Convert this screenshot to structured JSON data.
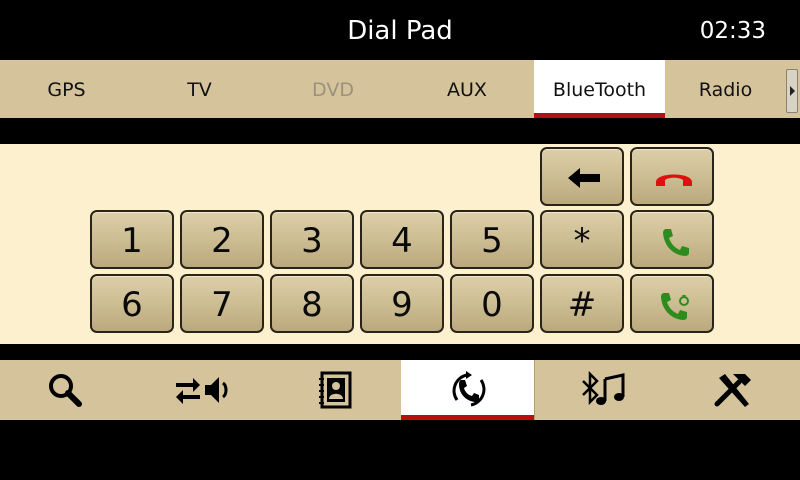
{
  "header": {
    "title": "Dial Pad",
    "clock": "02:33"
  },
  "tabs": [
    {
      "label": "GPS",
      "state": "normal"
    },
    {
      "label": "TV",
      "state": "normal"
    },
    {
      "label": "DVD",
      "state": "disabled"
    },
    {
      "label": "AUX",
      "state": "normal"
    },
    {
      "label": "BlueTooth",
      "state": "active"
    },
    {
      "label": "Radio",
      "state": "normal"
    }
  ],
  "keypad": {
    "row1": [
      "1",
      "2",
      "3",
      "4",
      "5",
      "*"
    ],
    "row2": [
      "6",
      "7",
      "8",
      "9",
      "0",
      "#"
    ]
  },
  "actions": {
    "backspace_icon": "left-arrow-icon",
    "end_call_icon": "hang-up-phone-icon",
    "call_icon": "phone-icon",
    "redial_icon": "redial-phone-icon"
  },
  "bottom_nav": [
    {
      "icon": "search-icon",
      "active": false
    },
    {
      "icon": "audio-transfer-icon",
      "active": false
    },
    {
      "icon": "contacts-book-icon",
      "active": false
    },
    {
      "icon": "dialpad-phone-icon",
      "active": true
    },
    {
      "icon": "bluetooth-music-icon",
      "active": false
    },
    {
      "icon": "settings-tools-icon",
      "active": false
    }
  ],
  "colors": {
    "accent_red": "#b51010",
    "bar_beige": "#d5c39c",
    "panel_cream": "#fdf0cf",
    "call_green": "#2e8b1e",
    "hangup_red": "#e01010"
  }
}
